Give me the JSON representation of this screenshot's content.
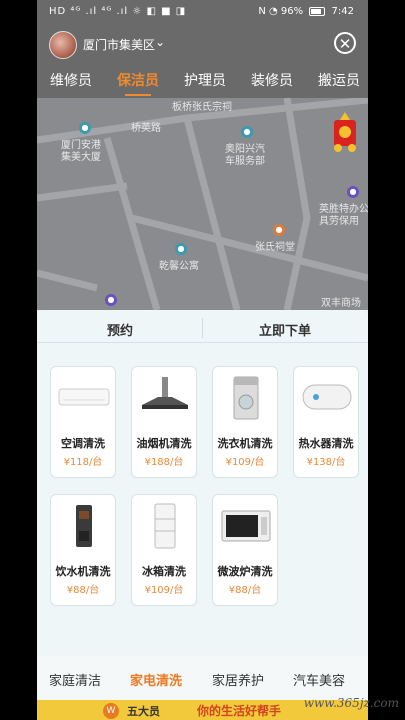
{
  "status_bar": {
    "left_icons": "HD ⁴ᴳ .ıl ⁴ᴳ .ıl ☼ ◧ ■ ◨",
    "nfc": "N",
    "battery": "96%",
    "time": "7:42"
  },
  "header": {
    "city": "厦门市集美区",
    "chevron": "⌄",
    "close": "✕"
  },
  "tabs": [
    "维修员",
    "保洁员",
    "护理员",
    "装修员",
    "搬运员"
  ],
  "active_tab": "保洁员",
  "map": {
    "labels": {
      "banqiao": "板桥张氏宗祠",
      "qiaoying": "桥英路",
      "anggang": "厦门安港\n集美大厦",
      "aoyang": "奥阳兴汽\n车服务部",
      "yingsheng": "英胜特办公\n具劳保用",
      "zhangci": "张氏祠堂",
      "qianxin": "乾馨公寓",
      "shuangfeng": "双丰商场"
    }
  },
  "order_modes": {
    "left": "预约",
    "right": "立即下单"
  },
  "services": [
    {
      "name": "空调清洗",
      "price": "¥118/台",
      "icon": "air-conditioner"
    },
    {
      "name": "油烟机清洗",
      "price": "¥188/台",
      "icon": "range-hood"
    },
    {
      "name": "洗衣机清洗",
      "price": "¥109/台",
      "icon": "washing-machine"
    },
    {
      "name": "热水器清洗",
      "price": "¥138/台",
      "icon": "water-heater"
    },
    {
      "name": "饮水机清洗",
      "price": "¥88/台",
      "icon": "water-dispenser"
    },
    {
      "name": "冰箱清洗",
      "price": "¥109/台",
      "icon": "refrigerator"
    },
    {
      "name": "微波炉清洗",
      "price": "¥88/台",
      "icon": "microwave"
    }
  ],
  "categories": [
    "家庭清洁",
    "家电清洗",
    "家居养护",
    "汽车美容"
  ],
  "active_category": "家电清洗",
  "banner": {
    "logo_mark": "W",
    "logo_text": "五大员",
    "slogan": "你的生活好帮手"
  },
  "watermark": "www.365jz.com",
  "colors": {
    "accent": "#f08a30",
    "price": "#e8893a",
    "banner": "#f3c93c"
  }
}
